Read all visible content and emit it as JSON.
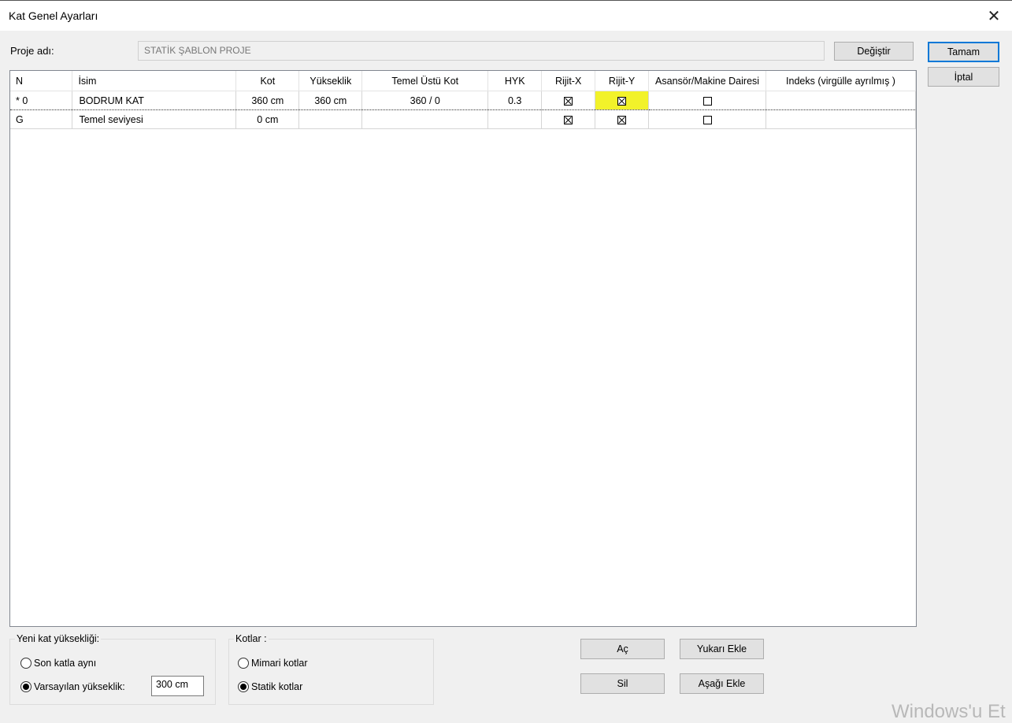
{
  "window": {
    "title": "Kat Genel Ayarları"
  },
  "project": {
    "label": "Proje adı:",
    "name": "STATİK ŞABLON PROJE",
    "change_button": "Değiştir"
  },
  "actions": {
    "ok": "Tamam",
    "cancel": "İptal"
  },
  "grid": {
    "columns": [
      "N",
      "İsim",
      "Kot",
      "Yükseklik",
      "Temel Üstü Kot",
      "HYK",
      "Rijit-X",
      "Rijit-Y",
      "Asansör/Makine Dairesi",
      "Indeks (virgülle ayrılmış )"
    ],
    "rows": [
      {
        "n": "* 0",
        "name": "BODRUM KAT",
        "kot": "360 cm",
        "height": "360 cm",
        "temel": "360 / 0",
        "hyk": "0.3",
        "rigid_x": true,
        "rigid_y": true,
        "elevator": false,
        "index": ""
      },
      {
        "n": "G",
        "name": "Temel seviyesi",
        "kot": "0 cm",
        "height": "",
        "temel": "",
        "hyk": "",
        "rigid_x": true,
        "rigid_y": true,
        "elevator": false,
        "index": ""
      }
    ],
    "highlight_color": "#f2f22a"
  },
  "new_floor": {
    "legend": "Yeni kat yüksekliği:",
    "opt_same": "Son katla aynı",
    "opt_default": "Varsayılan yükseklik:",
    "default_value": "300 cm"
  },
  "kotlar": {
    "legend": "Kotlar :",
    "opt_arch": "Mimari kotlar",
    "opt_static": "Statik kotlar"
  },
  "buttons": {
    "open": "Aç",
    "delete": "Sil",
    "add_above": "Yukarı Ekle",
    "add_below": "Aşağı Ekle"
  },
  "watermark": "Windows'u Et"
}
